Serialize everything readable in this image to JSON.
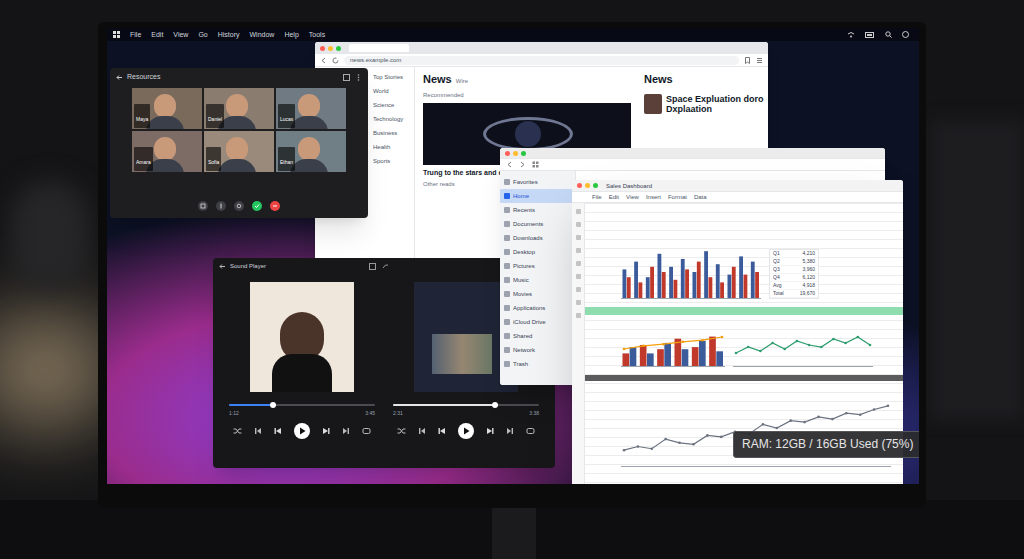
{
  "menubar": {
    "items": [
      "File",
      "Edit",
      "View",
      "Go",
      "History",
      "Window",
      "Help",
      "Tools"
    ]
  },
  "video_call": {
    "title": "Resources",
    "participants": [
      "Maya",
      "Daniel",
      "Lucas",
      "Amara",
      "Sofia",
      "Ethan"
    ],
    "controls": [
      {
        "color": "#3f3f46"
      },
      {
        "color": "#3f3f46"
      },
      {
        "color": "#3f3f46"
      },
      {
        "color": "#22c55e"
      },
      {
        "color": "#ef4444"
      }
    ]
  },
  "news_browser": {
    "address": "news.example.com",
    "sidebar": [
      "Top Stories",
      "World",
      "Science",
      "Technology",
      "Business",
      "Health",
      "Sports"
    ],
    "title": "News",
    "subtitle": "Wire",
    "section": "Recommended",
    "headline": "Trung to the stars and exploration",
    "more": "Other reads",
    "side_title": "News",
    "side_headline": "Space Expluation doro Dxplaation"
  },
  "files_browser": {
    "sidebar": [
      {
        "label": "Favorites",
        "selected": false
      },
      {
        "label": "Home",
        "selected": true
      },
      {
        "label": "Recents",
        "selected": false
      },
      {
        "label": "Documents",
        "selected": false
      },
      {
        "label": "Downloads",
        "selected": false
      },
      {
        "label": "Desktop",
        "selected": false
      },
      {
        "label": "Pictures",
        "selected": false
      },
      {
        "label": "Music",
        "selected": false
      },
      {
        "label": "Movies",
        "selected": false
      },
      {
        "label": "Applications",
        "selected": false
      },
      {
        "label": "iCloud Drive",
        "selected": false
      },
      {
        "label": "Shared",
        "selected": false
      },
      {
        "label": "Network",
        "selected": false
      },
      {
        "label": "Trash",
        "selected": false
      }
    ]
  },
  "spreadsheet": {
    "title": "Sales Dashboard",
    "toolbar": [
      "File",
      "Edit",
      "View",
      "Insert",
      "Format",
      "Data"
    ],
    "table": [
      [
        "Q1",
        "4,210"
      ],
      [
        "Q2",
        "5,380"
      ],
      [
        "Q3",
        "3,960"
      ],
      [
        "Q4",
        "6,120"
      ],
      [
        "Avg",
        "4,918"
      ],
      [
        "Total",
        "19,670"
      ]
    ],
    "charts": {
      "sales_bars": {
        "series": [
          {
            "kind": "bar",
            "color": "#3b5b9a",
            "values": [
              55,
              70,
              40,
              85,
              60,
              75,
              50,
              90,
              65,
              45,
              80,
              70
            ]
          },
          {
            "kind": "bar",
            "color": "#c0392b",
            "values": [
              40,
              30,
              60,
              50,
              35,
              55,
              70,
              40,
              30,
              60,
              45,
              50
            ]
          }
        ]
      },
      "mix": {
        "series": [
          {
            "kind": "bar",
            "color": "#c0392b",
            "values": [
              30,
              50,
              40,
              65,
              45,
              70
            ]
          },
          {
            "kind": "bar",
            "color": "#3b5b9a",
            "values": [
              45,
              30,
              55,
              40,
              60,
              35
            ]
          },
          {
            "kind": "line",
            "color": "#f59e0b",
            "values": [
              40,
              48,
              52,
              58,
              62,
              70
            ]
          }
        ]
      },
      "trend": {
        "series": [
          {
            "kind": "line",
            "color": "#2f9e6e",
            "values": [
              30,
              45,
              35,
              55,
              40,
              60,
              50,
              45,
              65,
              55,
              70,
              50
            ]
          }
        ]
      },
      "growth": {
        "series": [
          {
            "kind": "line",
            "color": "#6b7280",
            "values": [
              20,
              25,
              22,
              35,
              30,
              28,
              40,
              38,
              45,
              42,
              55,
              50,
              60,
              58,
              65,
              62,
              70,
              68,
              75,
              80
            ]
          }
        ]
      }
    }
  },
  "music": {
    "title": "Sound Player",
    "tracks": [
      {
        "level": 0.3,
        "elapsed": "1:12",
        "total": "3:45"
      },
      {
        "level": 0.7,
        "elapsed": "2:31",
        "total": "3:38"
      }
    ]
  },
  "tooltip": {
    "text": "RAM: 12GB / 16GB Used (75%)"
  }
}
